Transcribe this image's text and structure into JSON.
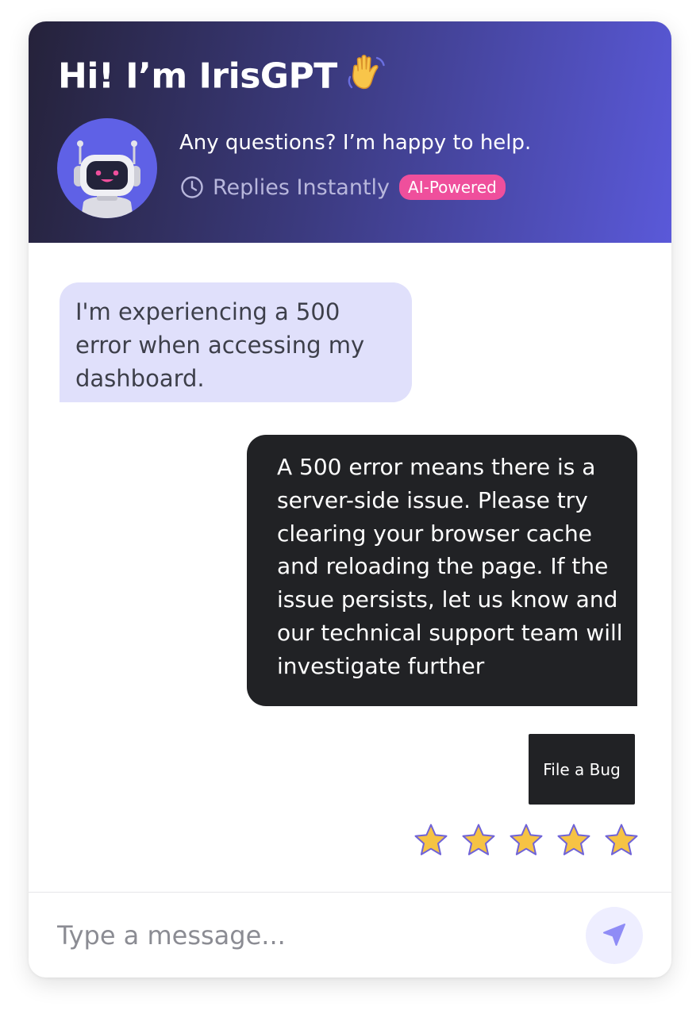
{
  "header": {
    "title": "Hi! I’m IrisGPT",
    "title_emoji_icon": "waving-hand-icon",
    "subtitle": "Any questions? I’m happy to help.",
    "reply_speed": "Replies Instantly",
    "badge": "AI-Powered",
    "avatar_icon": "robot-avatar-icon"
  },
  "messages": [
    {
      "role": "user",
      "text": "I'm experiencing a 500 error when accessing my dashboard."
    },
    {
      "role": "bot",
      "text": "A 500 error means there is a server-side issue. Please try clearing your browser cache and reloading the page. If the issue persists, let us know and our technical support team will investigate further"
    }
  ],
  "action_button": "File a Bug",
  "rating": {
    "max": 5,
    "icon": "star-icon"
  },
  "composer": {
    "placeholder": "Type a message...",
    "send_icon": "send-icon"
  },
  "colors": {
    "header_gradient_start": "#25223a",
    "header_gradient_end": "#5a59d9",
    "user_bubble": "#e0e0fb",
    "bot_bubble": "#212225",
    "badge": "#ef4f9c",
    "star_fill": "#f6c344",
    "star_stroke": "#6f63d8",
    "send_button_bg": "#eeeeff",
    "send_icon": "#8f8cf6"
  }
}
